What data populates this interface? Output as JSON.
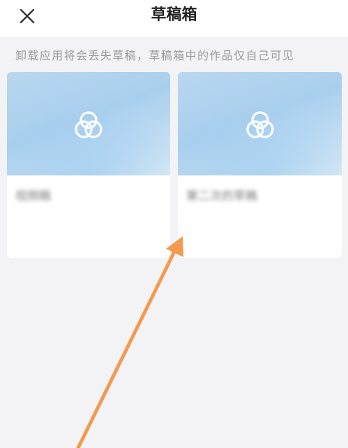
{
  "header": {
    "title": "草稿箱",
    "close_icon": "close-icon"
  },
  "notice": {
    "text": "卸载应用将会丢失草稿，草稿箱中的作品仅自己可见"
  },
  "drafts": [
    {
      "title": "视频稿",
      "thumbnail_icon": "app-logo-icon"
    },
    {
      "title": "第二次的草稿",
      "thumbnail_icon": "app-logo-icon"
    }
  ],
  "annotation": {
    "arrow_color": "#f39a4f"
  }
}
